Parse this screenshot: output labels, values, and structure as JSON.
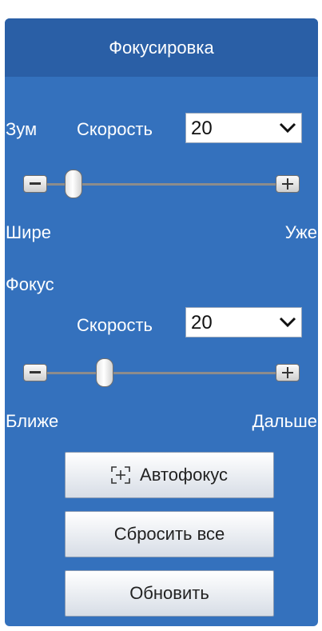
{
  "panel": {
    "title": "Фокусировка"
  },
  "zoom": {
    "label": "Зум",
    "speed_label": "Скорость",
    "speed_value": "20",
    "slider_position": 0.05,
    "min_label": "Шире",
    "max_label": "Уже"
  },
  "focus": {
    "label": "Фокус",
    "speed_label": "Скорость",
    "speed_value": "20",
    "slider_position": 0.22,
    "min_label": "Ближе",
    "max_label": "Дальше"
  },
  "buttons": {
    "autofocus": "Автофокус",
    "reset_all": "Сбросить все",
    "refresh": "Обновить"
  },
  "icons": {
    "autofocus": "autofocus-icon",
    "dropdown": "chevron-down-icon",
    "decrease": "minus-icon",
    "increase": "plus-icon"
  },
  "colors": {
    "panel_bg": "#3471bd",
    "header_bg": "#2a5fa6",
    "text": "#ffffff"
  }
}
